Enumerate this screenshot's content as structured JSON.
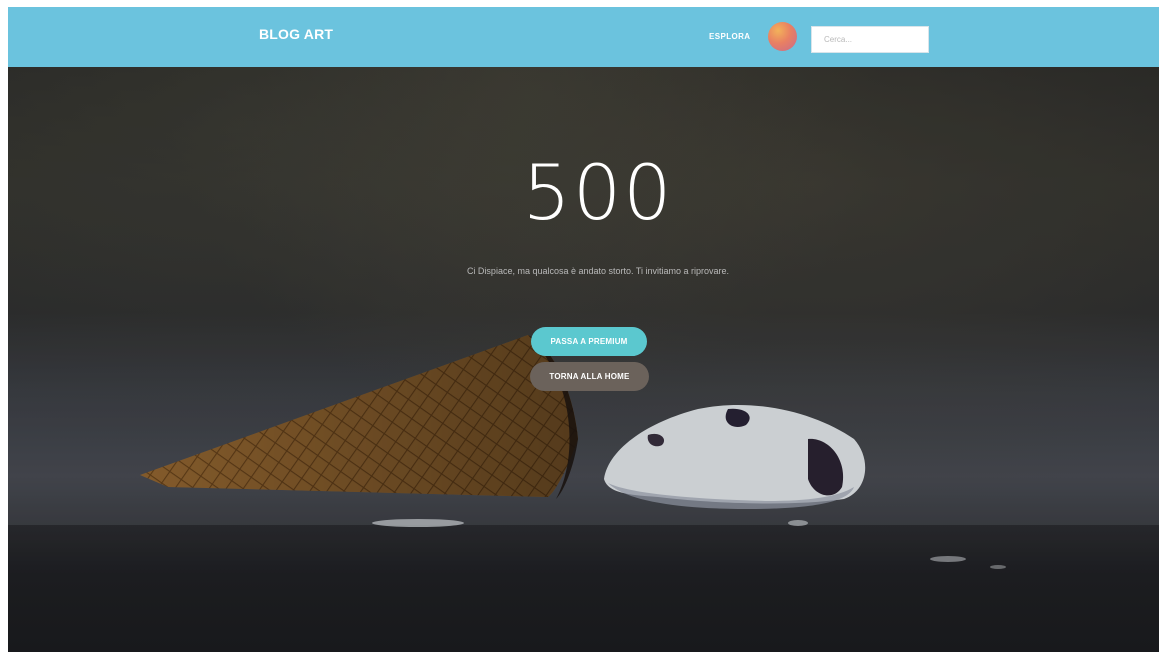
{
  "header": {
    "brand": "BLOG ART",
    "nav_explore": "ESPLORA",
    "search_placeholder": "Cerca..."
  },
  "error": {
    "code": "500",
    "message": "Ci Dispiace, ma qualcosa è andato storto. Ti invitiamo a riprovare."
  },
  "actions": {
    "premium_label": "PASSA A PREMIUM",
    "home_label": "TORNA ALLA HOME"
  },
  "colors": {
    "navbar": "#6bc3de",
    "premium_button": "#5bc8cf",
    "home_button": "#6b625b"
  },
  "icons": {
    "avatar": "avatar-icon"
  }
}
